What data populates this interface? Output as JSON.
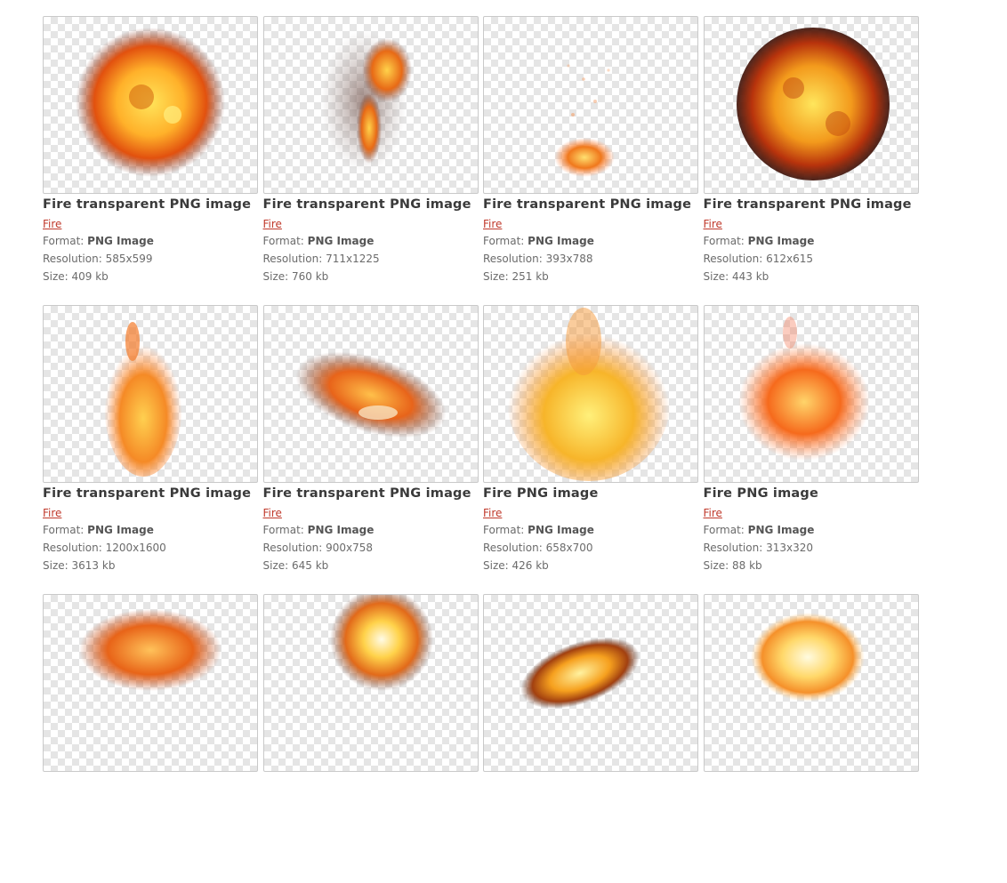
{
  "labels": {
    "format": "Format:",
    "resolution": "Resolution:",
    "size": "Size:"
  },
  "items": [
    {
      "title": "Fire transparent PNG image",
      "category": "Fire",
      "format": "PNG Image",
      "resolution": "585x599",
      "size": "409 kb",
      "icon": "fireball-image"
    },
    {
      "title": "Fire transparent PNG image",
      "category": "Fire",
      "format": "PNG Image",
      "resolution": "711x1225",
      "size": "760 kb",
      "icon": "smoke-fire-image"
    },
    {
      "title": "Fire transparent PNG image",
      "category": "Fire",
      "format": "PNG Image",
      "resolution": "393x788",
      "size": "251 kb",
      "icon": "small-flame-image"
    },
    {
      "title": "Fire transparent PNG image",
      "category": "Fire",
      "format": "PNG Image",
      "resolution": "612x615",
      "size": "443 kb",
      "icon": "explosion-image"
    },
    {
      "title": "Fire transparent PNG image",
      "category": "Fire",
      "format": "PNG Image",
      "resolution": "1200x1600",
      "size": "3613 kb",
      "icon": "tall-flame-image"
    },
    {
      "title": "Fire transparent PNG image",
      "category": "Fire",
      "format": "PNG Image",
      "resolution": "900x758",
      "size": "645 kb",
      "icon": "burning-streak-image"
    },
    {
      "title": "Fire PNG image",
      "category": "Fire",
      "format": "PNG Image",
      "resolution": "658x700",
      "size": "426 kb",
      "icon": "yellow-flame-image"
    },
    {
      "title": "Fire PNG image",
      "category": "Fire",
      "format": "PNG Image",
      "resolution": "313x320",
      "size": "88 kb",
      "icon": "flame-swirl-image"
    },
    {
      "title": "",
      "category": "",
      "format": "",
      "resolution": "",
      "size": "",
      "icon": "flame-patch-image"
    },
    {
      "title": "",
      "category": "",
      "format": "",
      "resolution": "",
      "size": "",
      "icon": "bright-burst-image"
    },
    {
      "title": "",
      "category": "",
      "format": "",
      "resolution": "",
      "size": "",
      "icon": "fire-jet-image"
    },
    {
      "title": "",
      "category": "",
      "format": "",
      "resolution": "",
      "size": "",
      "icon": "glow-burst-image"
    }
  ],
  "colors": {
    "link": "#c0392b",
    "title": "#3a3a3a",
    "border": "#c9c9c9"
  }
}
